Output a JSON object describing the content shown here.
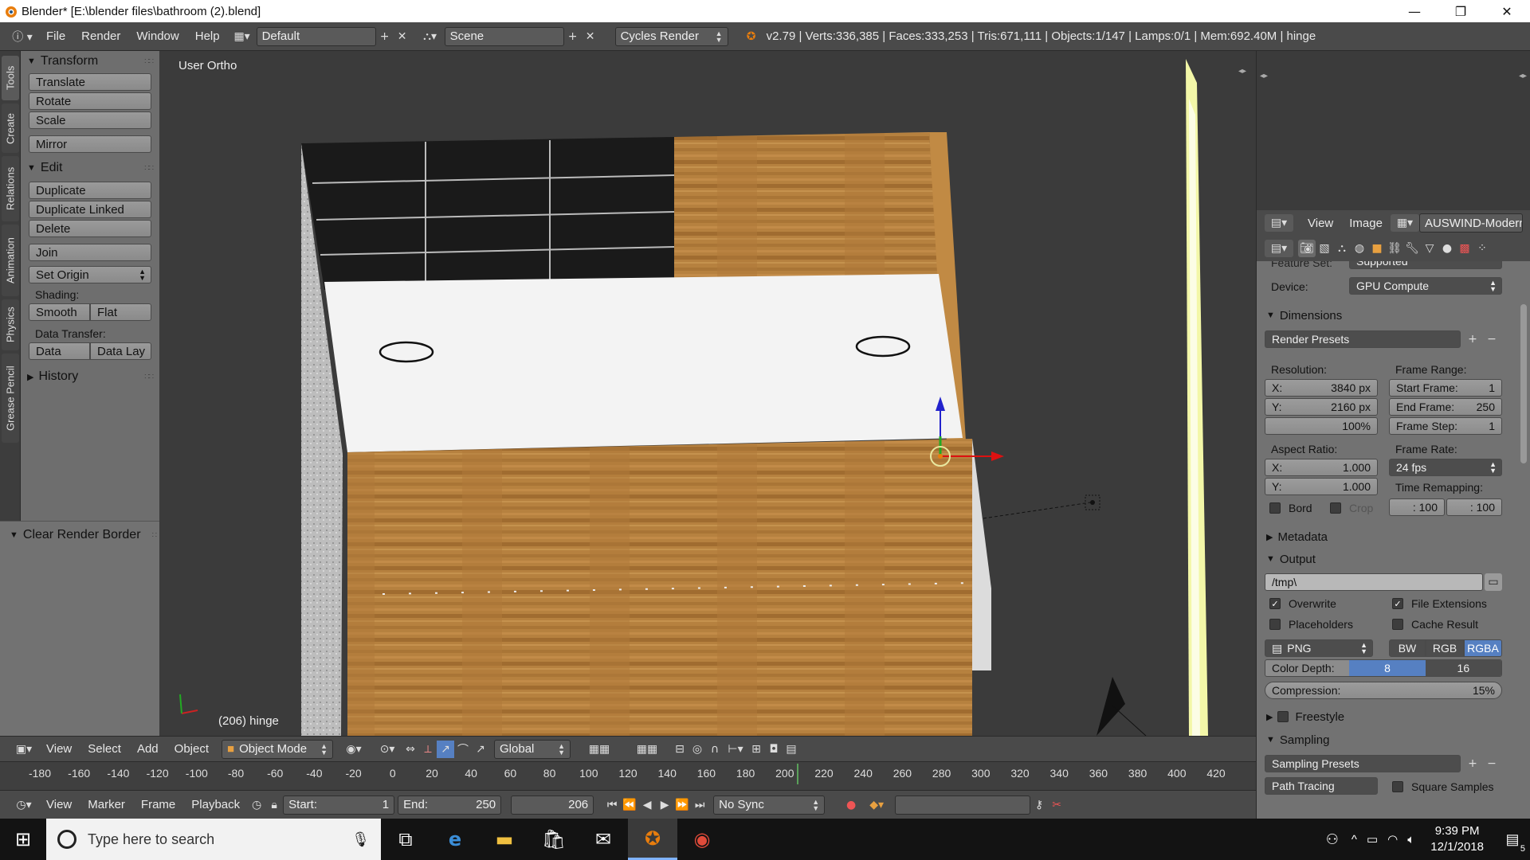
{
  "window": {
    "title": "Blender* [E:\\blender files\\bathroom (2).blend]",
    "controls": [
      "—",
      "❐",
      "✕"
    ]
  },
  "info_header": {
    "menus": [
      "File",
      "Render",
      "Window",
      "Help"
    ],
    "screen_layout": "Default",
    "scene": "Scene",
    "engine": "Cycles Render",
    "stats": "v2.79 | Verts:336,385 | Faces:333,253 | Tris:671,111 | Objects:1/147 | Lamps:0/1 | Mem:692.40M | hinge"
  },
  "tool_tabs": [
    "Tools",
    "Create",
    "Relations",
    "Animation",
    "Physics",
    "Grease Pencil"
  ],
  "tool_shelf": {
    "transform": {
      "title": "Transform",
      "buttons": [
        "Translate",
        "Rotate",
        "Scale",
        "Mirror"
      ]
    },
    "edit": {
      "title": "Edit",
      "buttons": [
        "Duplicate",
        "Duplicate Linked",
        "Delete",
        "Join"
      ],
      "set_origin": "Set Origin"
    },
    "shading": {
      "label": "Shading:",
      "smooth": "Smooth",
      "flat": "Flat"
    },
    "data_transfer": {
      "label": "Data Transfer:",
      "data": "Data",
      "data_lay": "Data Lay"
    },
    "history": "History",
    "operator_panel": "Clear Render Border"
  },
  "viewport": {
    "view_label": "User Ortho",
    "object_label": "(206) hinge"
  },
  "view3d_header": {
    "menus": [
      "View",
      "Select",
      "Add",
      "Object"
    ],
    "mode": "Object Mode",
    "orientation": "Global"
  },
  "timeline": {
    "ticks": [
      "-180",
      "-160",
      "-140",
      "-120",
      "-100",
      "-80",
      "-60",
      "-40",
      "-20",
      "0",
      "20",
      "40",
      "60",
      "80",
      "100",
      "120",
      "140",
      "160",
      "180",
      "200",
      "220",
      "240",
      "260",
      "280",
      "300",
      "320",
      "340",
      "360",
      "380",
      "400",
      "420"
    ],
    "current_frame": 206
  },
  "timeline_header": {
    "menus": [
      "View",
      "Marker",
      "Frame",
      "Playback"
    ],
    "start_label": "Start:",
    "start_value": "1",
    "end_label": "End:",
    "end_value": "250",
    "frame": "206",
    "sync": "No Sync"
  },
  "image_editor_header": {
    "menus": [
      "View",
      "Image"
    ],
    "image_name": "AUSWIND-Modern"
  },
  "properties": {
    "feature_set_label": "Feature Set:",
    "feature_set_value": "Supported",
    "device_label": "Device:",
    "device_value": "GPU Compute",
    "dimensions": {
      "title": "Dimensions",
      "render_presets": "Render Presets",
      "resolution_label": "Resolution:",
      "res_x_label": "X:",
      "res_x": "3840 px",
      "res_y_label": "Y:",
      "res_y": "2160 px",
      "res_percent": "100%",
      "frame_range_label": "Frame Range:",
      "start_frame_label": "Start Frame:",
      "start_frame": "1",
      "end_frame_label": "End Frame:",
      "end_frame": "250",
      "frame_step_label": "Frame Step:",
      "frame_step": "1",
      "aspect_label": "Aspect Ratio:",
      "aspect_x_label": "X:",
      "aspect_x": "1.000",
      "aspect_y_label": "Y:",
      "aspect_y": "1.000",
      "frame_rate_label": "Frame Rate:",
      "frame_rate": "24 fps",
      "time_remap_label": "Time Remapping:",
      "time_old": ": 100",
      "time_new": ": 100",
      "border_label": "Bord",
      "crop_label": "Crop"
    },
    "metadata_title": "Metadata",
    "output": {
      "title": "Output",
      "path": "/tmp\\",
      "overwrite": "Overwrite",
      "file_extensions": "File Extensions",
      "placeholders": "Placeholders",
      "cache_result": "Cache Result",
      "format": "PNG",
      "bw": "BW",
      "rgb": "RGB",
      "rgba": "RGBA",
      "color_depth_label": "Color Depth:",
      "depth_8": "8",
      "depth_16": "16",
      "compression_label": "Compression:",
      "compression": "15%"
    },
    "freestyle_title": "Freestyle",
    "sampling": {
      "title": "Sampling",
      "presets": "Sampling Presets",
      "integrator": "Path Tracing",
      "square_samples": "Square Samples"
    }
  },
  "taskbar": {
    "search_placeholder": "Type here to search",
    "time": "9:39 PM",
    "date": "12/1/2018",
    "notifications": "5"
  }
}
